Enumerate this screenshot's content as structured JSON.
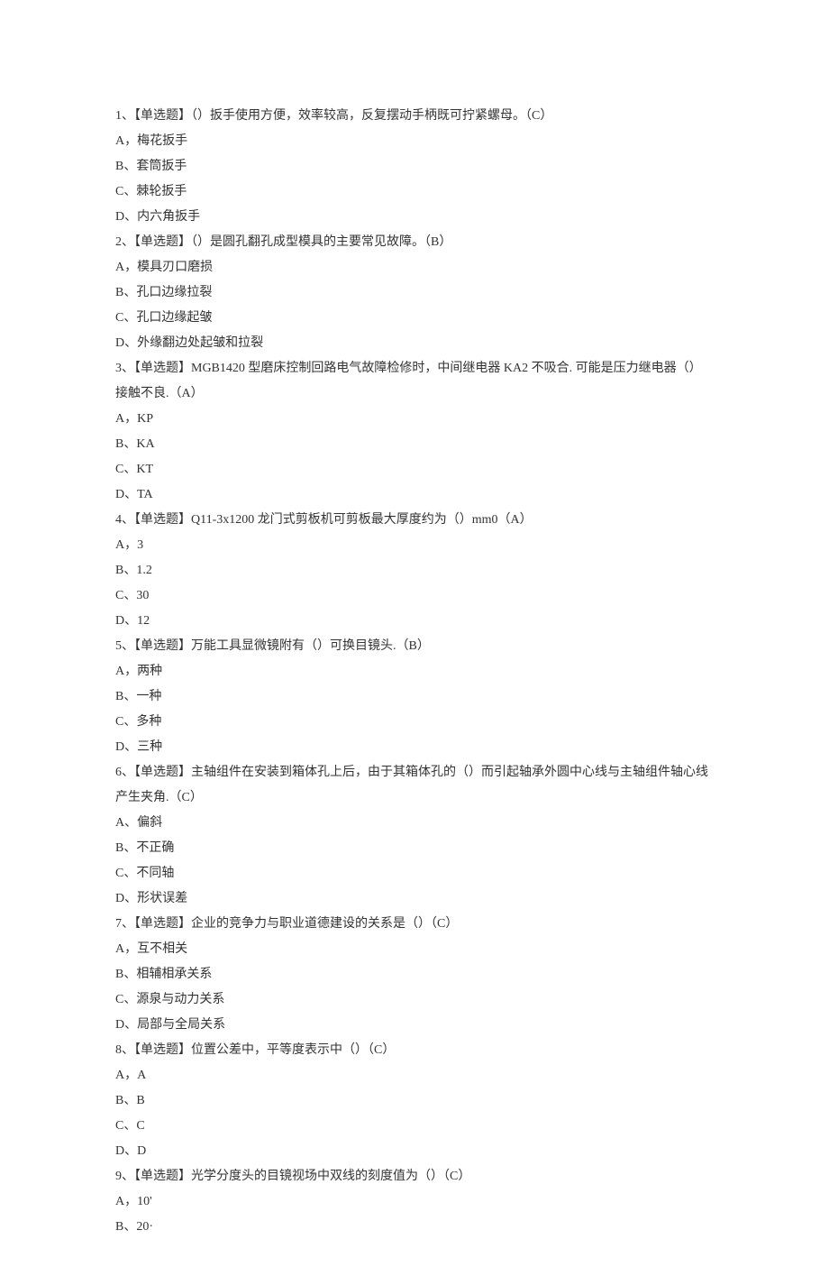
{
  "questions": [
    {
      "number": "1、",
      "type": "【单选题】",
      "text": "（）扳手使用方便，效率较高，反复摆动手柄既可拧紧螺母。（C）",
      "options": [
        "A，梅花扳手",
        "B、套筒扳手",
        "C、棘轮扳手",
        "D、内六角扳手"
      ]
    },
    {
      "number": "2、",
      "type": "【单选题】",
      "text": "（）是圆孔翻孔成型模具的主要常见故障。（B）",
      "options": [
        "A，模具刃口磨损",
        "B、孔口边缘拉裂",
        "C、孔口边缘起皱",
        "D、外缘翻边处起皱和拉裂"
      ]
    },
    {
      "number": "3、",
      "type": "【单选题】",
      "text": "MGB1420 型磨床控制回路电气故障检修时，中间继电器 KA2 不吸合. 可能是压力继电器（）接触不良.（A）",
      "options": [
        "A，KP",
        "B、KA",
        "C、KT",
        "D、TA"
      ]
    },
    {
      "number": "4、",
      "type": "【单选题】",
      "text": "Q11-3x1200 龙门式剪板机可剪板最大厚度约为（）mm0（A）",
      "options": [
        "A，3",
        "B、1.2",
        "C、30",
        "D、12"
      ]
    },
    {
      "number": "5、",
      "type": "【单选题】",
      "text": "万能工具显微镜附有（）可换目镜头.（B）",
      "options": [
        "A，两种",
        "B、一种",
        "C、多种",
        "D、三种"
      ]
    },
    {
      "number": "6、",
      "type": "【单选题】",
      "text": "主轴组件在安装到箱体孔上后，由于其箱体孔的（）而引起轴承外圆中心线与主轴组件轴心线产生夹角.（C）",
      "options": [
        "A、偏斜",
        "B、不正确",
        "C、不同轴",
        "D、形状误差"
      ]
    },
    {
      "number": "7、",
      "type": "【单选题】",
      "text": "企业的竞争力与职业道德建设的关系是（）（C）",
      "options": [
        "A，互不相关",
        "B、相辅相承关系",
        "C、源泉与动力关系",
        "D、局部与全局关系"
      ]
    },
    {
      "number": "8、",
      "type": "【单选题】",
      "text": "位置公差中，平等度表示中（）（C）",
      "options": [
        "A，A",
        "B、B",
        "C、C",
        "D、D"
      ]
    },
    {
      "number": "9、",
      "type": "【单选题】",
      "text": "光学分度头的目镜视场中双线的刻度值为（）（C）",
      "options": [
        "A，10'",
        "B、20·"
      ]
    }
  ]
}
